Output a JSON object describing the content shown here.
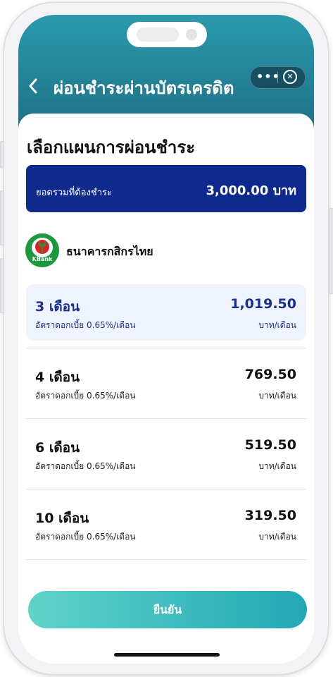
{
  "header": {
    "title": "ผ่อนชำระผ่านบัตรเครดิต",
    "back_icon": "chevron-left-icon",
    "more_icon": "more-dots-icon",
    "close_icon": "close-circle-icon"
  },
  "sheet": {
    "title": "เลือกแผนการผ่อนชำระ",
    "total": {
      "label": "ยอดรวมที่ต้องชำระ",
      "amount": "3,000.00 บาท"
    },
    "bank": {
      "logo_text": "KBank",
      "name": "ธนาคารกสิกรไทย"
    },
    "plans": [
      {
        "months": "3 เดือน",
        "rate": "อัตราดอกเบี้ย 0.65%/เดือน",
        "amount": "1,019.50",
        "unit": "บาท/เดือน",
        "selected": true
      },
      {
        "months": "4 เดือน",
        "rate": "อัตราดอกเบี้ย 0.65%/เดือน",
        "amount": "769.50",
        "unit": "บาท/เดือน",
        "selected": false
      },
      {
        "months": "6 เดือน",
        "rate": "อัตราดอกเบี้ย 0.65%/เดือน",
        "amount": "519.50",
        "unit": "บาท/เดือน",
        "selected": false
      },
      {
        "months": "10 เดือน",
        "rate": "อัตราดอกเบี้ย 0.65%/เดือน",
        "amount": "319.50",
        "unit": "บาท/เดือน",
        "selected": false
      }
    ],
    "confirm_label": "ยืนยัน"
  },
  "colors": {
    "header_gradient_start": "#2a9aac",
    "header_gradient_end": "#1f6e86",
    "total_card": "#0f2a8f",
    "selected_plan_bg": "#eef3fd",
    "confirm_gradient_start": "#5fd3c9",
    "confirm_gradient_end": "#22a8b5",
    "kbank_green": "#1a9a3c"
  }
}
